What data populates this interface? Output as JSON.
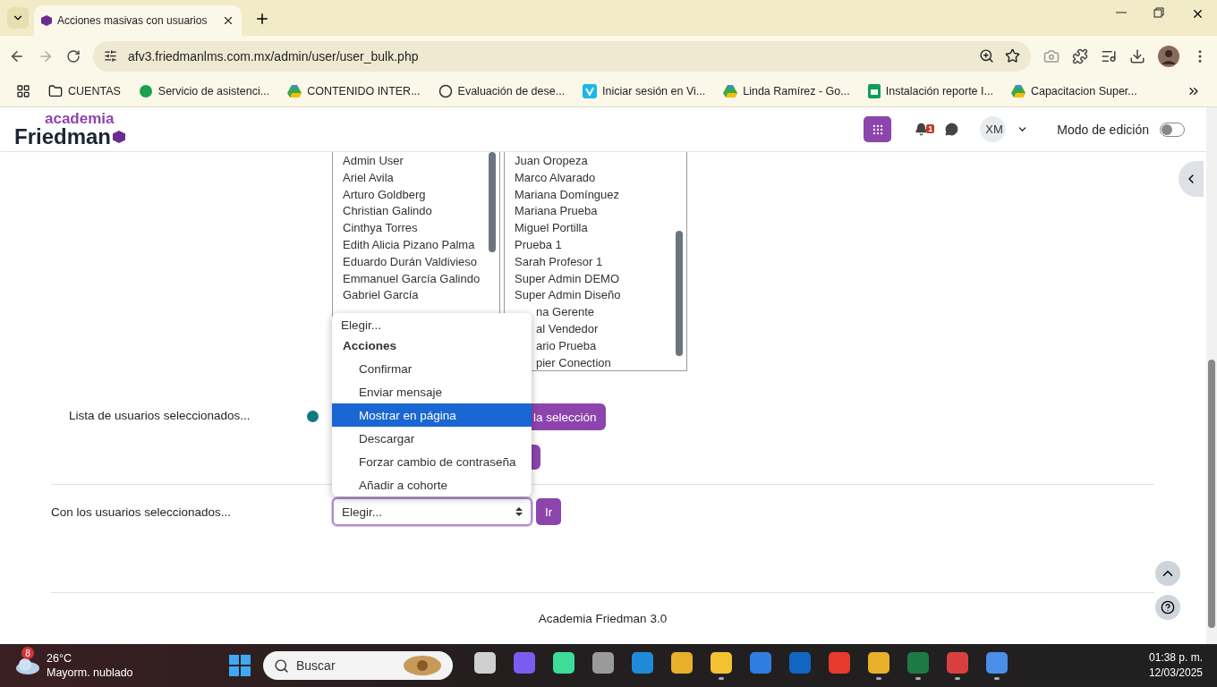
{
  "browser": {
    "tab_title": "Acciones masivas con usuarios",
    "url": "afv3.friedmanlms.com.mx/admin/user/user_bulk.php",
    "bookmarks": [
      {
        "kind": "folder",
        "label": "CUENTAS"
      },
      {
        "kind": "support",
        "label": "Servicio de asistenci..."
      },
      {
        "kind": "drive",
        "label": "CONTENIDO INTER..."
      },
      {
        "kind": "af",
        "label": "Evaluación de dese..."
      },
      {
        "kind": "vimeo",
        "label": "Iniciar sesión en Vi..."
      },
      {
        "kind": "drive",
        "label": "Linda Ramírez - Go..."
      },
      {
        "kind": "sheets",
        "label": "Instalación reporte I..."
      },
      {
        "kind": "drive",
        "label": "Capacitacion Super..."
      }
    ]
  },
  "header": {
    "logo_top": "academia",
    "logo_bottom": "Friedman",
    "notification_count": "1",
    "avatar": "XM",
    "edit_mode_label": "Modo de edición",
    "edit_mode_on": false
  },
  "available_users": [
    "Admin User",
    "Ariel Avila",
    "Arturo Goldberg",
    "Christian Galindo",
    "Cinthya Torres",
    "Edith Alicia Pizano Palma",
    "Eduardo Durán Valdivieso",
    "Emmanuel García Galindo",
    "Gabriel García"
  ],
  "selected_users": [
    {
      "kind": "full",
      "name": "Juan Oropeza"
    },
    {
      "kind": "full",
      "name": "Marco Alvarado"
    },
    {
      "kind": "full",
      "name": "Mariana Domínguez"
    },
    {
      "kind": "full",
      "name": "Mariana Prueba"
    },
    {
      "kind": "full",
      "name": "Miguel Portilla"
    },
    {
      "kind": "full",
      "name": "Prueba 1"
    },
    {
      "kind": "full",
      "name": "Sarah Profesor 1"
    },
    {
      "kind": "full",
      "name": "Super Admin DEMO"
    },
    {
      "kind": "full",
      "name": "Super Admin Diseño"
    },
    {
      "kind": "partial",
      "name": "na Gerente"
    },
    {
      "kind": "partial",
      "name": "al Vendedor"
    },
    {
      "kind": "partial",
      "name": "ario Prueba"
    },
    {
      "kind": "partial",
      "name": "pier Conection"
    }
  ],
  "selected_list_label": "Lista de usuarios seleccionados...",
  "selection_button": "la selección",
  "action_label": "Con los usuarios seleccionados...",
  "action_select": {
    "value": "Elegir...",
    "go_button": "Ir"
  },
  "dropdown": {
    "placeholder": "Elegir...",
    "group": "Acciones",
    "options": [
      {
        "label": "Confirmar",
        "selected": false
      },
      {
        "label": "Enviar mensaje",
        "selected": false
      },
      {
        "label": "Mostrar en página",
        "selected": true
      },
      {
        "label": "Descargar",
        "selected": false
      },
      {
        "label": "Forzar cambio de contraseña",
        "selected": false
      },
      {
        "label": "Añadir a cohorte",
        "selected": false
      }
    ]
  },
  "footer": "Academia Friedman 3.0",
  "taskbar": {
    "weather_badge": "8",
    "temperature": "26°C",
    "condition": "Mayorm. nublado",
    "search_placeholder": "Buscar",
    "time": "01:38 p. m.",
    "date": "12/03/2025",
    "apps": [
      {
        "color": "#d0d0d0",
        "running": false
      },
      {
        "color": "#7b5cf0",
        "running": false
      },
      {
        "color": "#3ddc97",
        "running": false
      },
      {
        "color": "#9a9a9a",
        "running": false
      },
      {
        "color": "#1f8ad8",
        "running": false
      },
      {
        "color": "#e8b02a",
        "running": false
      },
      {
        "color": "#f2c230",
        "running": true
      },
      {
        "color": "#2f7de0",
        "running": false
      },
      {
        "color": "#1066c0",
        "running": false
      },
      {
        "color": "#e8392f",
        "running": false
      },
      {
        "color": "#e8b02a",
        "running": true
      },
      {
        "color": "#1d7a45",
        "running": true
      },
      {
        "color": "#d84040",
        "running": true
      },
      {
        "color": "#4a8ee8",
        "running": true
      }
    ]
  }
}
